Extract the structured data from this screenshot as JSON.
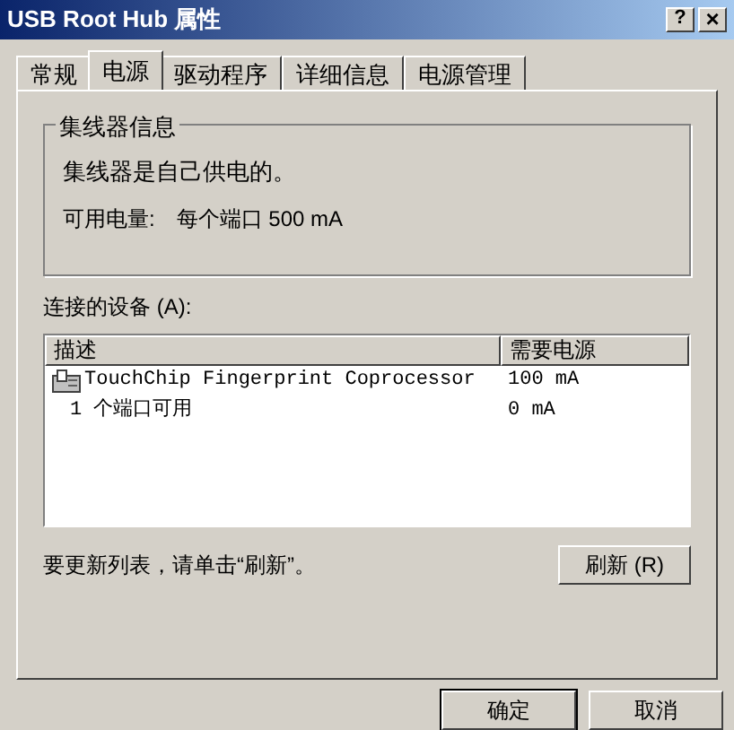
{
  "window": {
    "title": "USB Root Hub 属性",
    "help_button": "?",
    "close_button": "×"
  },
  "tabs": [
    {
      "label": "常规",
      "selected": false
    },
    {
      "label": "电源",
      "selected": true
    },
    {
      "label": "驱动程序",
      "selected": false
    },
    {
      "label": "详细信息",
      "selected": false
    },
    {
      "label": "电源管理",
      "selected": false
    }
  ],
  "hub_info": {
    "title": "集线器信息",
    "status": "集线器是自己供电的。",
    "power_label": "可用电量:",
    "power_value": "每个端口 500 mA"
  },
  "devices": {
    "label": "连接的设备 (A):",
    "columns": [
      "描述",
      "需要电源"
    ],
    "rows": [
      {
        "kind": "device",
        "name": "TouchChip Fingerprint Coprocessor",
        "power": "100 mA"
      },
      {
        "kind": "free",
        "name": "1 个端口可用",
        "power": "0 mA"
      }
    ]
  },
  "hint": "要更新列表，请单击“刷新”。",
  "refresh_button": "刷新 (R)",
  "buttons": [
    {
      "label": "确定",
      "default": true
    },
    {
      "label": "取消",
      "default": false
    }
  ]
}
